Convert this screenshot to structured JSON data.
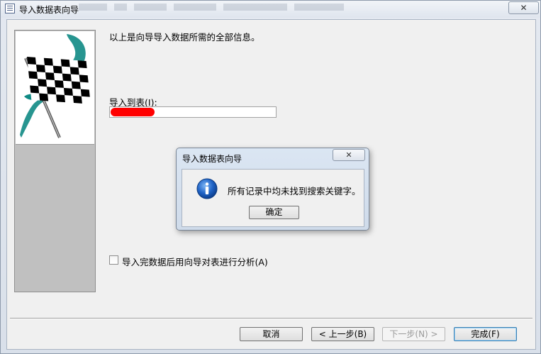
{
  "window": {
    "title": "导入数据表向导",
    "close_glyph": "✕"
  },
  "wizard": {
    "intro": "以上是向导导入数据所需的全部信息。",
    "import_to_table_label": "导入到表(I):",
    "table_name_value": "",
    "analyze_label": "导入完数据后用向导对表进行分析(A)",
    "analyze_checked": false,
    "buttons": {
      "cancel": "取消",
      "back": "< 上一步(B)",
      "next": "下一步(N) >",
      "finish": "完成(F)"
    }
  },
  "message_box": {
    "title": "导入数据表向导",
    "close_glyph": "✕",
    "icon": "info-icon",
    "message": "所有记录中均未找到搜索关键字。",
    "ok_label": "确定"
  },
  "colors": {
    "info_blue": "#1f63c6",
    "flag_teal": "#0f8a84",
    "redaction": "#ff0000"
  }
}
